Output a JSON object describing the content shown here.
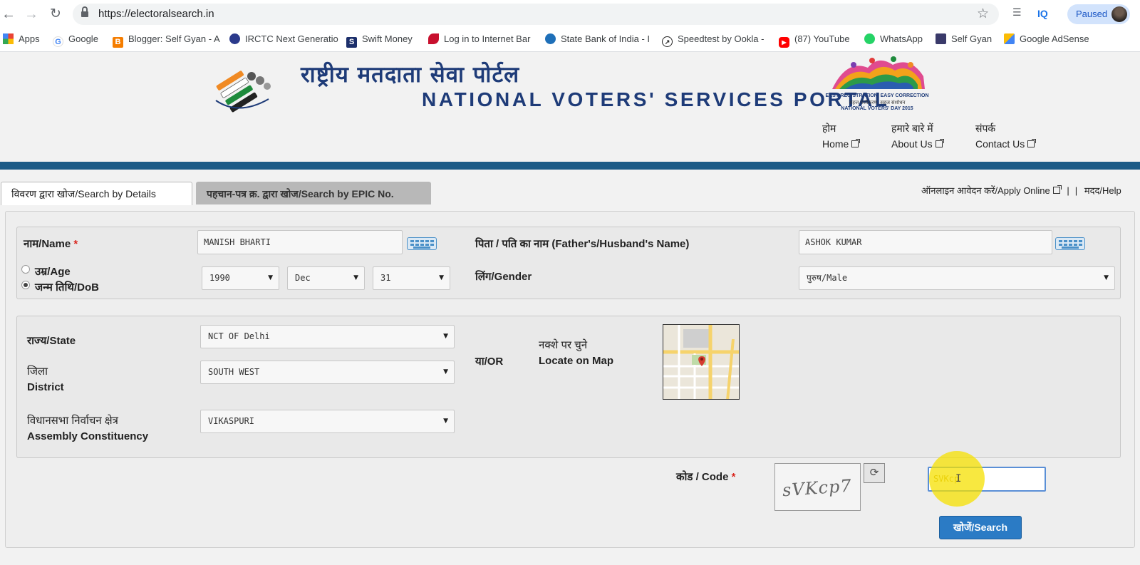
{
  "browser": {
    "url": "https://electoralsearch.in",
    "profile_status": "Paused",
    "extension_iq": "IQ",
    "bookmarks": [
      {
        "label": "Apps",
        "icon": "apps-grid-icon"
      },
      {
        "label": "Google",
        "icon": "google-icon"
      },
      {
        "label": "Blogger: Self Gyan - A",
        "icon": "blogger-icon"
      },
      {
        "label": "IRCTC Next Generatio",
        "icon": "irctc-icon"
      },
      {
        "label": "Swift Money",
        "icon": "swift-money-icon"
      },
      {
        "label": "Log in to Internet Bar",
        "icon": "bank-login-icon"
      },
      {
        "label": "State Bank of India - I",
        "icon": "sbi-icon"
      },
      {
        "label": "Speedtest by Ookla -",
        "icon": "speedtest-icon"
      },
      {
        "label": "(87) YouTube",
        "icon": "youtube-icon"
      },
      {
        "label": "WhatsApp",
        "icon": "whatsapp-icon"
      },
      {
        "label": "Self Gyan",
        "icon": "self-gyan-icon"
      },
      {
        "label": "Google AdSense",
        "icon": "adsense-icon"
      }
    ]
  },
  "header": {
    "hindi_title": "राष्ट्रीय मतदाता सेवा पोर्टल",
    "english_title": "NATIONAL VOTERS' SERVICES PORTAL",
    "nvd_line1": "EASY REGISTRATION, EASY CORRECTION",
    "nvd_line2": "सहज पंजीकरण, सहज संशोधन",
    "nvd_line3": "NATIONAL VOTERS' DAY 2015",
    "nav": [
      {
        "hi": "होम",
        "en": "Home"
      },
      {
        "hi": "हमारे बारे में",
        "en": "About Us"
      },
      {
        "hi": "संपर्क",
        "en": "Contact Us"
      }
    ]
  },
  "tabs": {
    "search_by_details": "विवरण द्वारा खोज/Search by Details",
    "search_by_epic": "पहचान-पत्र क्र. द्वारा खोज/Search by EPIC No.",
    "apply_online": "ऑनलाइन आवेदन करें/Apply Online",
    "help": "मदद/Help"
  },
  "form": {
    "name_label": "नाम/Name",
    "name_value": "MANISH BHARTI",
    "father_label": "पिता / पति का नाम (Father's/Husband's Name)",
    "father_value": "ASHOK KUMAR",
    "age_label": "उम्र/Age",
    "dob_label": "जन्म तिथि/DoB",
    "dob_year": "1990",
    "dob_month": "Dec",
    "dob_day": "31",
    "gender_label": "लिंग/Gender",
    "gender_value": "पुरुष/Male",
    "state_label": "राज्य/State",
    "state_value": "NCT OF Delhi",
    "district_label_hi": "जिला",
    "district_label_en": "District",
    "district_value": "SOUTH WEST",
    "ac_label_hi": "विधानसभा निर्वाचन क्षेत्र",
    "ac_label_en": "Assembly Constituency",
    "ac_value": "VIKASPURI",
    "or_label": "या/OR",
    "map_label_hi": "नक्शे पर चुने",
    "map_label_en": "Locate on Map",
    "code_label": "कोड / Code",
    "captcha_text": "sVKcp7",
    "code_value": "SVKcp",
    "search_label": "खोजें/Search",
    "required_mark": "*"
  },
  "colors": {
    "brand_navy": "#1e3b78",
    "header_bar": "#1c5b87",
    "search_button": "#2b7bc5",
    "required": "#d9251d"
  }
}
